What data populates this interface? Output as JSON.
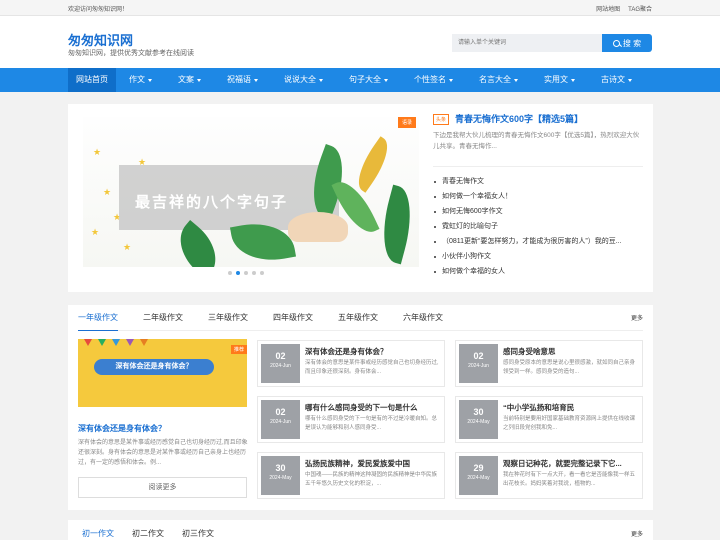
{
  "topbar": {
    "welcome": "欢迎访问匆匆知识网！",
    "links": [
      "网站地图",
      "TAG聚合"
    ]
  },
  "header": {
    "logo": "匆匆知识网",
    "slogan": "匆匆知识网，提供优秀文献参考在线阅读",
    "search_placeholder": "请输入单个关键词",
    "search_button": "搜 索"
  },
  "nav": {
    "items": [
      {
        "label": "网站首页",
        "caret": false
      },
      {
        "label": "作文",
        "caret": true
      },
      {
        "label": "文案",
        "caret": true
      },
      {
        "label": "祝福语",
        "caret": true
      },
      {
        "label": "说说大全",
        "caret": true
      },
      {
        "label": "句子大全",
        "caret": true
      },
      {
        "label": "个性签名",
        "caret": true
      },
      {
        "label": "名言大全",
        "caret": true
      },
      {
        "label": "实用文",
        "caret": true
      },
      {
        "label": "古诗文",
        "caret": true
      }
    ]
  },
  "hero": {
    "banner_title": "最吉祥的八个字句子",
    "banner_tag": "语录",
    "hot_tag": "头条",
    "hot_title": "青春无悔作文600字【精选5篇】",
    "hot_desc": "下边是我帮大伙儿梳理的青春无悔作文600字【优选5篇】，热烈欢迎大伙儿共享。青春无悔作...",
    "list": [
      "青春无悔作文",
      "如何做一个幸福女人！",
      "如何无悔600字作文",
      "霓虹灯的比喻句子",
      "（0811更新“要怎样努力，才能成为很厉害的人”）我的豆...",
      "小伙伴小狗作文",
      "如何做个幸福的女人"
    ]
  },
  "grade": {
    "tabs": [
      "一年级作文",
      "二年级作文",
      "三年级作文",
      "四年级作文",
      "五年级作文",
      "六年级作文"
    ],
    "more": "更多",
    "feature": {
      "img_text": "深有体会还是身有体会？",
      "img_badge": "推荐",
      "title": "深有体会还是身有体会？",
      "desc": "深有体会的意思是某件事或经历感觉自己也切身经历过,而且印象还很深刻。身有体会的意思是对某件事或经历自己亲身上也经历过，有一定的感悟和体会。例...",
      "read_more": "阅读更多"
    },
    "cards": [
      {
        "day": "02",
        "month": "2024-Jun",
        "title": "深有体会还是身有体会？",
        "desc": "深有体会的意思是某件事或经历感觉自己也切身经历过,而且印象还很深刻。身有体会..."
      },
      {
        "day": "02",
        "month": "2024-Jun",
        "title": "感同身受啥意思",
        "desc": "感同身受原本的意思是说心里很感激，就如同自己亲身领受到一样。感同身受的造句..."
      },
      {
        "day": "02",
        "month": "2024-Jun",
        "title": "哪有什么感同身受的下一句是什么",
        "desc": "哪有什么感同身受的下一句是有的不过是冷暖自知。总是误认为能够和别人感同身受..."
      },
      {
        "day": "30",
        "month": "2024-May",
        "title": "“中小学弘扬和培育民",
        "desc": "当前特别是要用好国家基础教育资源网上提供在线收课之列旧段党创我和免..."
      },
      {
        "day": "30",
        "month": "2024-May",
        "title": "弘扬民族精神，爱民爱族爱中国",
        "desc": "中国魂——民族的精神这种凝固的民族精神是中华民族五千年悠久历史文化的积淀，..."
      },
      {
        "day": "29",
        "month": "2024-May",
        "title": "观察日记种花，就要完整记录下它...",
        "desc": "我在种花时有下一点大开，看一看它是否能像我一样五出花枝长。妈妈笑着对我说，植物的..."
      }
    ]
  },
  "middle": {
    "tabs": [
      "初一作文",
      "初二作文",
      "初三作文"
    ],
    "more": "更多"
  }
}
